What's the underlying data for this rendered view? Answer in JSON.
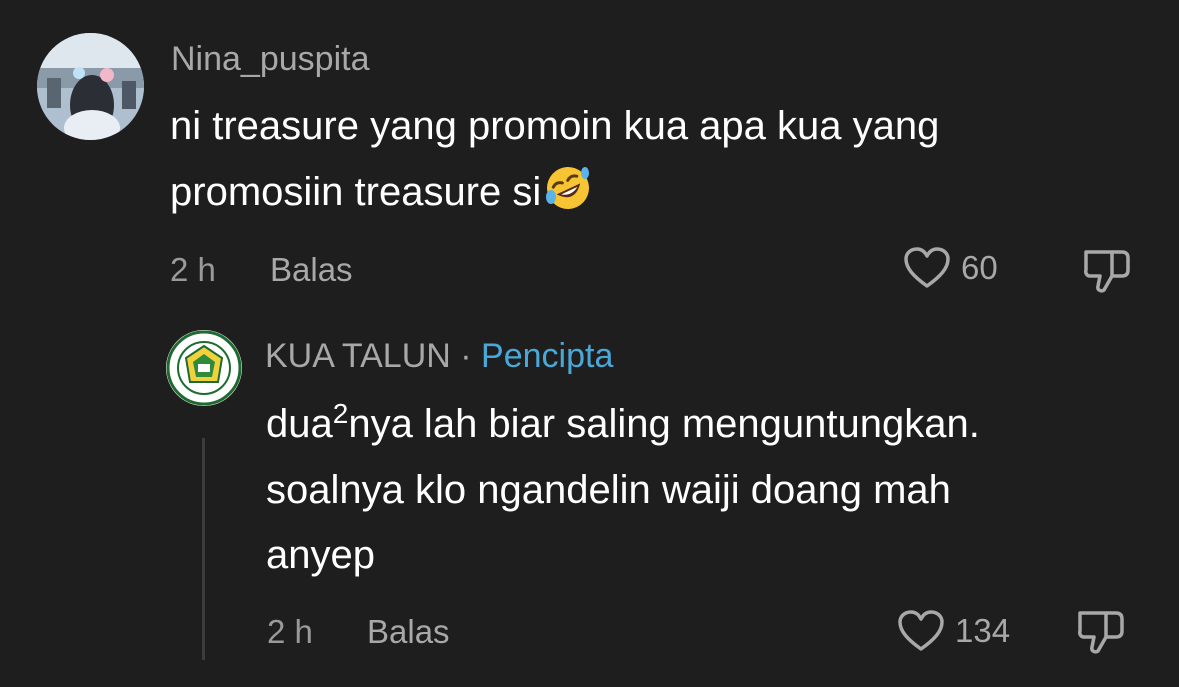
{
  "comment": {
    "username": "Nina_puspita",
    "text_line1": "ni treasure yang promoin kua apa kua yang",
    "text_line2": "promosiin treasure si",
    "emoji": "rolling-on-floor-laughing",
    "time": "2 h",
    "reply_label": "Balas",
    "likes": "60"
  },
  "reply": {
    "username": "KUA TALUN",
    "separator": "·",
    "creator_label": "Pencipta",
    "text_part1": "dua",
    "text_sup": "2",
    "text_part2": "nya lah biar saling menguntungkan.",
    "text_line2": "soalnya klo ngandelin waiji doang mah",
    "text_line3": "anyep",
    "time": "2 h",
    "reply_label": "Balas",
    "likes": "134"
  },
  "colors": {
    "background": "#1e1e1e",
    "creator_accent": "#4aa8d8",
    "muted_text": "#a8a8a8",
    "primary_text": "#ffffff"
  },
  "icons": {
    "like": "heart-outline-icon",
    "dislike": "thumbs-down-outline-icon"
  }
}
